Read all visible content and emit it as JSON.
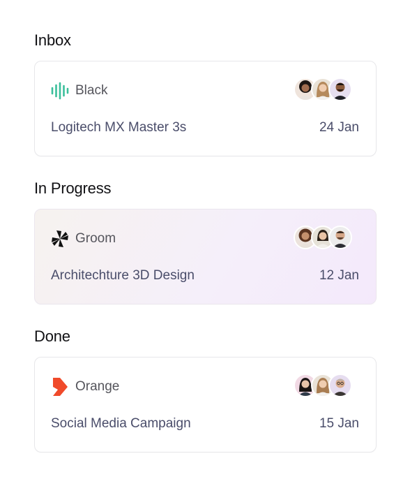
{
  "sections": [
    {
      "title": "Inbox",
      "card": {
        "brand": "Black",
        "brand_icon": "audio-wave-icon",
        "brand_color": "#3bbf9b",
        "task": "Logitech MX Master 3s",
        "date": "24 Jan",
        "avatars": [
          "avatar-woman-curly-hair",
          "avatar-woman-long-hair",
          "avatar-man-beard"
        ]
      }
    },
    {
      "title": "In Progress",
      "card": {
        "brand": "Groom",
        "brand_icon": "pinwheel-icon",
        "brand_color": "#111111",
        "task": "Architechture 3D Design",
        "date": "12 Jan",
        "avatars": [
          "avatar-woman-curly-hair",
          "avatar-woman-short-hair",
          "avatar-man-beard"
        ]
      }
    },
    {
      "title": "Done",
      "card": {
        "brand": "Orange",
        "brand_icon": "arrow-chevron-icon",
        "brand_color": "#f04a2a",
        "task": "Social Media Campaign",
        "date": "15 Jan",
        "avatars": [
          "avatar-woman-dark-hair",
          "avatar-woman-long-hair",
          "avatar-man-glasses"
        ]
      }
    }
  ]
}
